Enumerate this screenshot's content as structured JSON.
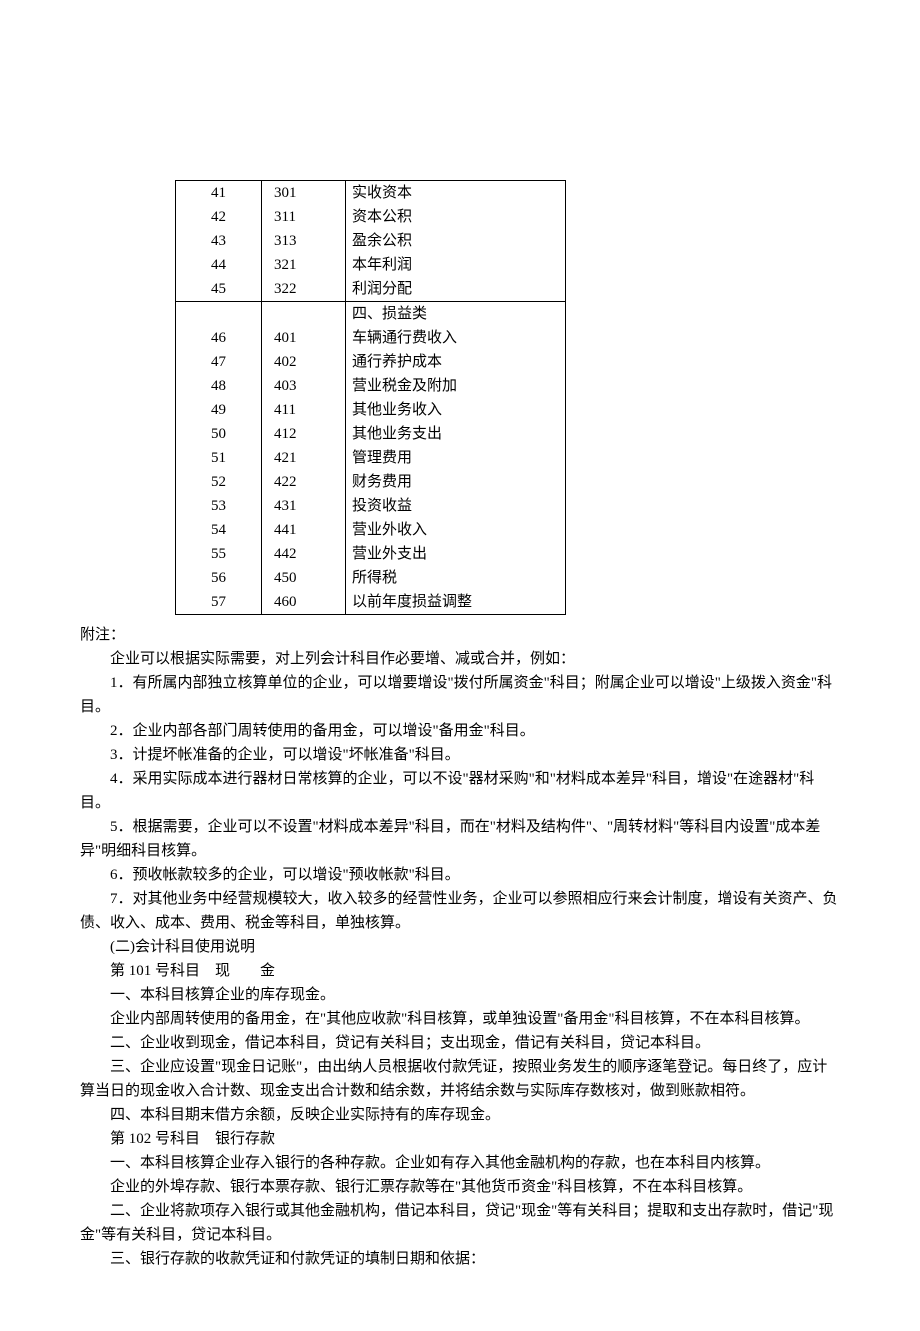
{
  "tableA": [
    {
      "n": "41",
      "code": "301",
      "name": "实收资本"
    },
    {
      "n": "42",
      "code": "311",
      "name": "资本公积"
    },
    {
      "n": "43",
      "code": "313",
      "name": "盈余公积"
    },
    {
      "n": "44",
      "code": "321",
      "name": "本年利润"
    },
    {
      "n": "45",
      "code": "322",
      "name": "利润分配"
    }
  ],
  "section_header": "四、损益类",
  "tableB": [
    {
      "n": "46",
      "code": "401",
      "name": "车辆通行费收入"
    },
    {
      "n": "47",
      "code": "402",
      "name": "通行养护成本"
    },
    {
      "n": "48",
      "code": "403",
      "name": "营业税金及附加"
    },
    {
      "n": "49",
      "code": "411",
      "name": "其他业务收入"
    },
    {
      "n": "50",
      "code": "412",
      "name": "其他业务支出"
    },
    {
      "n": "51",
      "code": "421",
      "name": "管理费用"
    },
    {
      "n": "52",
      "code": "422",
      "name": "财务费用"
    },
    {
      "n": "53",
      "code": "431",
      "name": "投资收益"
    },
    {
      "n": "54",
      "code": "441",
      "name": "营业外收入"
    },
    {
      "n": "55",
      "code": "442",
      "name": "营业外支出"
    },
    {
      "n": "56",
      "code": "450",
      "name": "所得税"
    },
    {
      "n": "57",
      "code": "460",
      "name": "以前年度损益调整"
    }
  ],
  "paras": {
    "p0": "附注：",
    "p1": "企业可以根据实际需要，对上列会计科目作必要增、减或合并，例如：",
    "p2": "1．有所属内部独立核算单位的企业，可以增要增设\"拨付所属资金\"科目；附属企业可以增设\"上级拨入资金\"科目。",
    "p3": "2．企业内部各部门周转使用的备用金，可以增设\"备用金\"科目。",
    "p4": "3．计提坏帐准备的企业，可以增设\"坏帐准备\"科目。",
    "p5": "4．采用实际成本进行器材日常核算的企业，可以不设\"器材采购\"和\"材料成本差异\"科目，增设\"在途器材\"科目。",
    "p6": "5．根据需要，企业可以不设置\"材料成本差异\"科目，而在\"材料及结构件\"、\"周转材料\"等科目内设置\"成本差异\"明细科目核算。",
    "p7": "6．预收帐款较多的企业，可以增设\"预收帐款\"科目。",
    "p8": "7．对其他业务中经营规模较大，收入较多的经营性业务，企业可以参照相应行来会计制度，增设有关资产、负债、收入、成本、费用、税金等科目，单独核算。",
    "p9": "(二)会计科目使用说明",
    "p10": "第 101 号科目　现　　金",
    "p11": "一、本科目核算企业的库存现金。",
    "p12": "企业内部周转使用的备用金，在\"其他应收款\"科目核算，或单独设置\"备用金\"科目核算，不在本科目核算。",
    "p13": "二、企业收到现金，借记本科目，贷记有关科目；支出现金，借记有关科目，贷记本科目。",
    "p14": "三、企业应设置\"现金日记账\"，由出纳人员根据收付款凭证，按照业务发生的顺序逐笔登记。每日终了，应计算当日的现金收入合计数、现金支出合计数和结余数，并将结余数与实际库存数核对，做到账款相符。",
    "p15": "四、本科目期末借方余额，反映企业实际持有的库存现金。",
    "p16": "第 102 号科目　银行存款",
    "p17": "一、本科目核算企业存入银行的各种存款。企业如有存入其他金融机构的存款，也在本科目内核算。",
    "p18": "企业的外埠存款、银行本票存款、银行汇票存款等在\"其他货币资金\"科目核算，不在本科目核算。",
    "p19": "二、企业将款项存入银行或其他金融机构，借记本科目，贷记\"现金\"等有关科目；提取和支出存款时，借记\"现金\"等有关科目，贷记本科目。",
    "p20": "三、银行存款的收款凭证和付款凭证的填制日期和依据："
  }
}
